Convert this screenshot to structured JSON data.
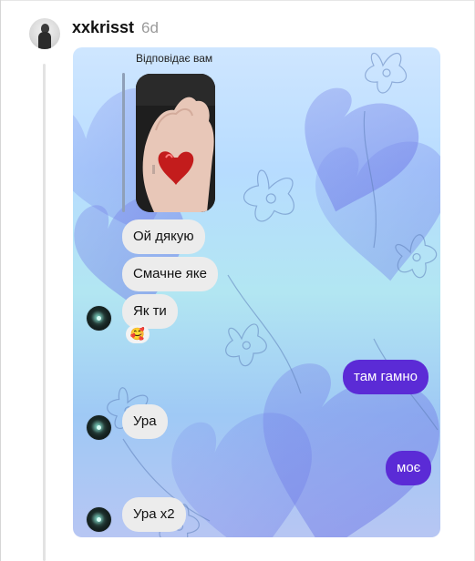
{
  "comment": {
    "username": "xxkrisst",
    "time": "6d"
  },
  "chat": {
    "reply_label": "Відповідає вам",
    "messages": [
      {
        "side": "in",
        "text": "Ой дякую"
      },
      {
        "side": "in",
        "text": "Смачне яке"
      },
      {
        "side": "in",
        "text": "Як ти"
      },
      {
        "side": "out",
        "text": "там гамно"
      },
      {
        "side": "in",
        "text": "Ура"
      },
      {
        "side": "out",
        "text": "моє"
      },
      {
        "side": "in",
        "text": "Ура x2"
      }
    ],
    "reaction_emoji": "🥰"
  },
  "colors": {
    "outgoing_bubble": "#5b2bd6",
    "incoming_bubble": "#ececec",
    "username": "#111111",
    "timestamp": "#9a9a9a"
  }
}
